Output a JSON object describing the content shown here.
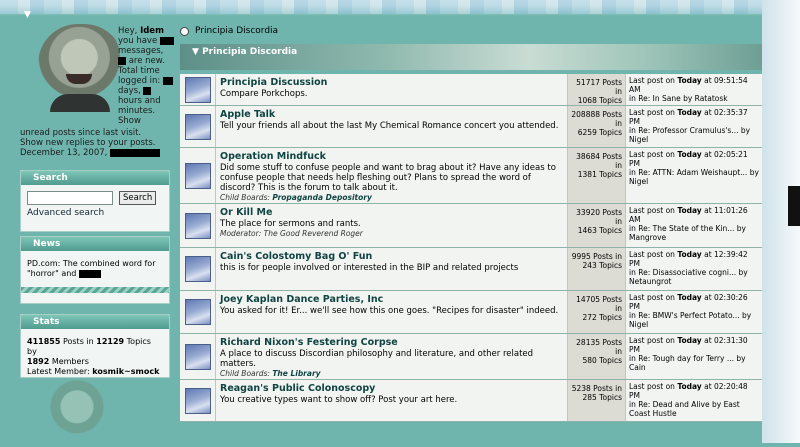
{
  "user": {
    "greeting": "Hey,",
    "name": "Idem",
    "you_have": "you have",
    "messages_suffix": "messages,",
    "new_suffix": "are new.",
    "time_logged": "Total time logged in:",
    "days": "days,",
    "hours_minutes": "hours and minutes.",
    "show": "Show",
    "unread_link": "unread posts since last visit.",
    "replies_link": "Show new replies to your posts.",
    "date": "December 13, 2007,"
  },
  "search": {
    "title": "Search",
    "button_label": "Search",
    "advanced_link": "Advanced search",
    "placeholder": ""
  },
  "news": {
    "title": "News",
    "text": "PD.com: The combined word for \"horror\" and"
  },
  "stats": {
    "title": "Stats",
    "posts": "411855",
    "posts_label": "Posts in",
    "topics": "12129",
    "topics_label": "Topics by",
    "members": "1892",
    "members_label": "Members",
    "latest_label": "Latest Member:",
    "latest_member": "kosmik~smock"
  },
  "breadcrumb": {
    "label": "Principia Discordia"
  },
  "category": {
    "title": "Principia Discordia"
  },
  "boards": [
    {
      "name": "Principia Discussion",
      "desc": "Compare Porkchops.",
      "child_label": "",
      "child": "",
      "posts": "51717 Posts in",
      "topics": "1068 Topics",
      "last_prefix": "Last post on",
      "last_day": "Today",
      "last_time": "at 09:51:54 AM",
      "last_in": "in Re: In Sane by Ratatosk"
    },
    {
      "name": "Apple Talk",
      "desc": "Tell your friends all about the last My Chemical Romance concert you attended.",
      "child_label": "",
      "child": "",
      "posts": "208888 Posts in",
      "topics": "6259 Topics",
      "last_prefix": "Last post on",
      "last_day": "Today",
      "last_time": "at 02:35:37 PM",
      "last_in": "in Re: Professor Cramulus's... by Nigel"
    },
    {
      "name": "Operation Mindfuck",
      "desc": "Did some stuff to confuse people and want to brag about it? Have any ideas to confuse people that needs help fleshing out? Plans to spread the word of discord? This is the forum to talk about it.",
      "child_label": "Child Boards:",
      "child": "Propaganda Depository",
      "posts": "38684 Posts in",
      "topics": "1381 Topics",
      "last_prefix": "Last post on",
      "last_day": "Today",
      "last_time": "at 02:05:21 PM",
      "last_in": "in Re: ATTN: Adam Weishaupt... by Nigel"
    },
    {
      "name": "Or Kill Me",
      "desc": "The place for sermons and rants.",
      "child_label": "Moderator:",
      "child": "The Good Reverend Roger",
      "posts": "33920 Posts in",
      "topics": "1463 Topics",
      "last_prefix": "Last post on",
      "last_day": "Today",
      "last_time": "at 11:01:26 AM",
      "last_in": "in Re: The State of the Kin... by Mangrove"
    },
    {
      "name": "Cain's Colostomy Bag O' Fun",
      "desc": "this is for people involved or interested in the BIP and related projects",
      "child_label": "",
      "child": "",
      "posts": "9995 Posts in",
      "topics": "243 Topics",
      "last_prefix": "Last post on",
      "last_day": "Today",
      "last_time": "at 12:39:42 PM",
      "last_in": "in Re: Disassociative cogni... by Netaungrot"
    },
    {
      "name": "Joey Kaplan Dance Parties, Inc",
      "desc": "You asked for it! Er... we'll see how this one goes. \"Recipes for disaster\" indeed.",
      "child_label": "",
      "child": "",
      "posts": "14705 Posts in",
      "topics": "272 Topics",
      "last_prefix": "Last post on",
      "last_day": "Today",
      "last_time": "at 02:30:26 PM",
      "last_in": "in Re: BMW's Perfect Potato... by Nigel"
    },
    {
      "name": "Richard Nixon's Festering Corpse",
      "desc": "A place to discuss Discordian philosophy and literature, and other related matters.",
      "child_label": "Child Boards:",
      "child": "The Library",
      "posts": "28135 Posts in",
      "topics": "580 Topics",
      "last_prefix": "Last post on",
      "last_day": "Today",
      "last_time": "at 02:31:30 PM",
      "last_in": "in Re: Tough day for Terry ... by Cain"
    },
    {
      "name": "Reagan's Public Colonoscopy",
      "desc": "You creative types want to show off? Post your art here.",
      "child_label": "",
      "child": "",
      "posts": "5238 Posts in",
      "topics": "285 Topics",
      "last_prefix": "Last post on",
      "last_day": "Today",
      "last_time": "at 02:20:48 PM",
      "last_in": "in Re: Dead and Alive by East Coast Hustle"
    }
  ]
}
